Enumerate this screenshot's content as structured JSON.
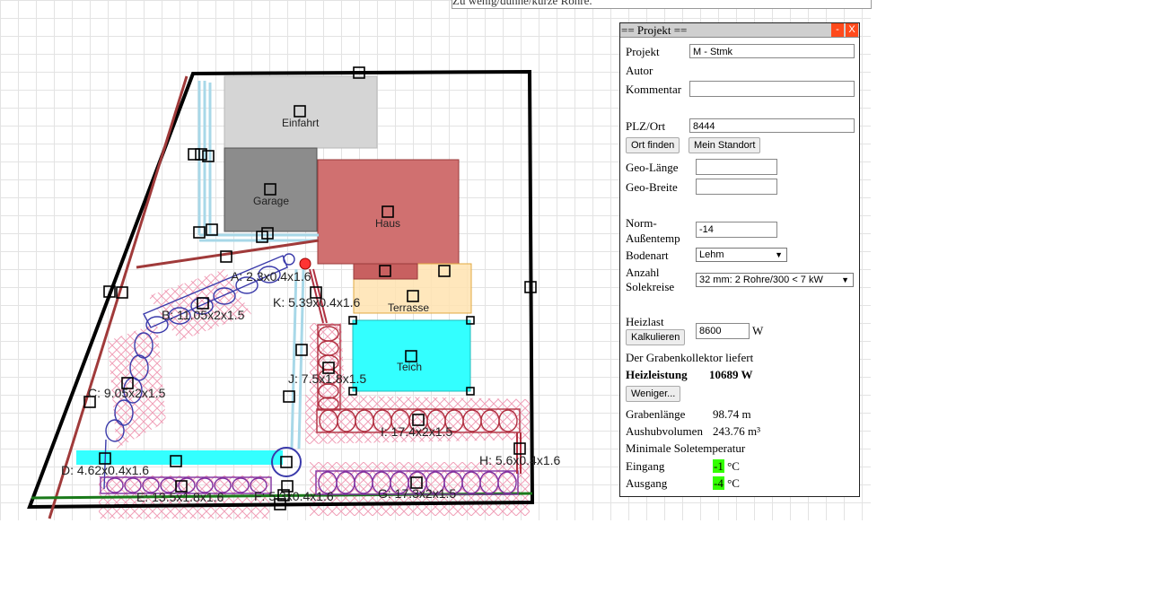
{
  "status_message": "Zu wenig/dünne/kurze Rohre.",
  "panel": {
    "title": "== Projekt ==",
    "minimize": "-",
    "close": "X",
    "projekt_label": "Projekt",
    "projekt_value": "M - Stmk",
    "autor_label": "Autor",
    "kommentar_label": "Kommentar",
    "plz_label": "PLZ/Ort",
    "plz_value": "8444",
    "ort_finden": "Ort finden",
    "mein_standort": "Mein Standort",
    "geo_laenge": "Geo-Länge",
    "geo_breite": "Geo-Breite",
    "norm_label_1": "Norm-",
    "norm_label_2": "Außentemp",
    "norm_value": "-14",
    "bodenart_label": "Bodenart",
    "bodenart_value": "Lehm",
    "anzahl_label_1": "Anzahl",
    "anzahl_label_2": "Solekreise",
    "anzahl_value": "32 mm: 2 Rohre/300 < 7 kW",
    "heizlast_label": "Heizlast",
    "heizlast_value": "8600",
    "heizlast_unit": "W",
    "kalkulieren": "Kalkulieren",
    "liefert_text": "Der Grabenkollektor liefert",
    "heizleistung_label": "Heizleistung",
    "heizleistung_value": "10689 W",
    "weniger": "Weniger...",
    "grabenlaenge_label": "Grabenlänge",
    "grabenlaenge_value": "98.74 m",
    "aushub_label": "Aushubvolumen",
    "aushub_value": "243.76 m³",
    "min_sole": "Minimale Soletemperatur",
    "eingang_label": "Eingang",
    "eingang_value": "-1",
    "ausgang_label": "Ausgang",
    "ausgang_value": "-4",
    "temp_unit": "°C"
  },
  "plan": {
    "areas": {
      "einfahrt": "Einfahrt",
      "garage": "Garage",
      "haus": "Haus",
      "terrasse": "Terrasse",
      "teich": "Teich"
    },
    "trenches": {
      "a": "A: 2.3x0.4x1.6",
      "b": "B: 11.05x2x1.5",
      "c": "C: 9.05x2x1.5",
      "d": "D: 4.62x0.4x1.6",
      "e": "E: 13.5x1.8x1.6",
      "f": "F: 5.3x0.4x1.6",
      "g": "G: 17.3x2x1.5",
      "h": "H: 5.6x0.4x1.6",
      "i": "I: 17.4x2x1.5",
      "j": "J: 7.5x1.8x1.5",
      "k": "K: 5.39x0.4x1.6"
    },
    "colors": {
      "lot_border": "#000000",
      "property_line": "#a03a3a",
      "einfahrt": "#d5d5d5",
      "garage": "#8c8c8c",
      "haus": "#d07070",
      "terrasse": "#ffe3b0",
      "teich": "#33ffff",
      "pipe_blue": "#3a3aaa",
      "pipe_red": "#b03040",
      "pipe_purple": "#8030a0",
      "hatch": "#f0a0b8",
      "supply_lines": "#a8d8e8",
      "ground_line": "#1a7a1a"
    }
  }
}
